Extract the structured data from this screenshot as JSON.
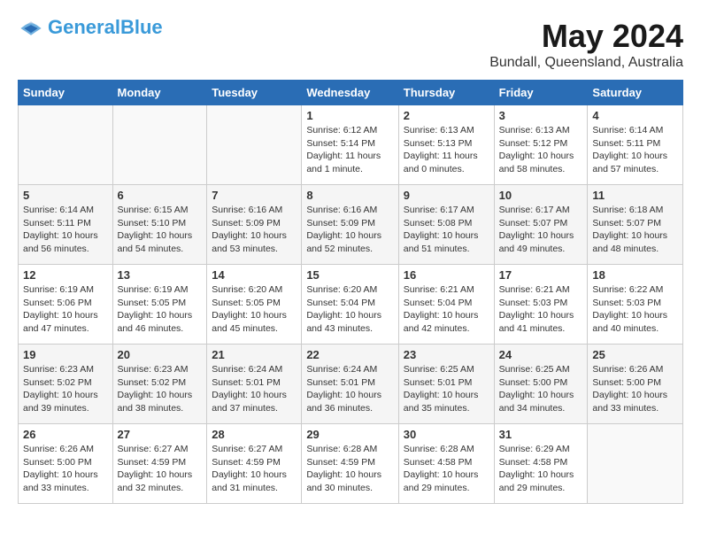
{
  "header": {
    "logo_general": "General",
    "logo_blue": "Blue",
    "month": "May 2024",
    "location": "Bundall, Queensland, Australia"
  },
  "weekdays": [
    "Sunday",
    "Monday",
    "Tuesday",
    "Wednesday",
    "Thursday",
    "Friday",
    "Saturday"
  ],
  "weeks": [
    [
      {
        "day": "",
        "info": ""
      },
      {
        "day": "",
        "info": ""
      },
      {
        "day": "",
        "info": ""
      },
      {
        "day": "1",
        "info": "Sunrise: 6:12 AM\nSunset: 5:14 PM\nDaylight: 11 hours\nand 1 minute."
      },
      {
        "day": "2",
        "info": "Sunrise: 6:13 AM\nSunset: 5:13 PM\nDaylight: 11 hours\nand 0 minutes."
      },
      {
        "day": "3",
        "info": "Sunrise: 6:13 AM\nSunset: 5:12 PM\nDaylight: 10 hours\nand 58 minutes."
      },
      {
        "day": "4",
        "info": "Sunrise: 6:14 AM\nSunset: 5:11 PM\nDaylight: 10 hours\nand 57 minutes."
      }
    ],
    [
      {
        "day": "5",
        "info": "Sunrise: 6:14 AM\nSunset: 5:11 PM\nDaylight: 10 hours\nand 56 minutes."
      },
      {
        "day": "6",
        "info": "Sunrise: 6:15 AM\nSunset: 5:10 PM\nDaylight: 10 hours\nand 54 minutes."
      },
      {
        "day": "7",
        "info": "Sunrise: 6:16 AM\nSunset: 5:09 PM\nDaylight: 10 hours\nand 53 minutes."
      },
      {
        "day": "8",
        "info": "Sunrise: 6:16 AM\nSunset: 5:09 PM\nDaylight: 10 hours\nand 52 minutes."
      },
      {
        "day": "9",
        "info": "Sunrise: 6:17 AM\nSunset: 5:08 PM\nDaylight: 10 hours\nand 51 minutes."
      },
      {
        "day": "10",
        "info": "Sunrise: 6:17 AM\nSunset: 5:07 PM\nDaylight: 10 hours\nand 49 minutes."
      },
      {
        "day": "11",
        "info": "Sunrise: 6:18 AM\nSunset: 5:07 PM\nDaylight: 10 hours\nand 48 minutes."
      }
    ],
    [
      {
        "day": "12",
        "info": "Sunrise: 6:19 AM\nSunset: 5:06 PM\nDaylight: 10 hours\nand 47 minutes."
      },
      {
        "day": "13",
        "info": "Sunrise: 6:19 AM\nSunset: 5:05 PM\nDaylight: 10 hours\nand 46 minutes."
      },
      {
        "day": "14",
        "info": "Sunrise: 6:20 AM\nSunset: 5:05 PM\nDaylight: 10 hours\nand 45 minutes."
      },
      {
        "day": "15",
        "info": "Sunrise: 6:20 AM\nSunset: 5:04 PM\nDaylight: 10 hours\nand 43 minutes."
      },
      {
        "day": "16",
        "info": "Sunrise: 6:21 AM\nSunset: 5:04 PM\nDaylight: 10 hours\nand 42 minutes."
      },
      {
        "day": "17",
        "info": "Sunrise: 6:21 AM\nSunset: 5:03 PM\nDaylight: 10 hours\nand 41 minutes."
      },
      {
        "day": "18",
        "info": "Sunrise: 6:22 AM\nSunset: 5:03 PM\nDaylight: 10 hours\nand 40 minutes."
      }
    ],
    [
      {
        "day": "19",
        "info": "Sunrise: 6:23 AM\nSunset: 5:02 PM\nDaylight: 10 hours\nand 39 minutes."
      },
      {
        "day": "20",
        "info": "Sunrise: 6:23 AM\nSunset: 5:02 PM\nDaylight: 10 hours\nand 38 minutes."
      },
      {
        "day": "21",
        "info": "Sunrise: 6:24 AM\nSunset: 5:01 PM\nDaylight: 10 hours\nand 37 minutes."
      },
      {
        "day": "22",
        "info": "Sunrise: 6:24 AM\nSunset: 5:01 PM\nDaylight: 10 hours\nand 36 minutes."
      },
      {
        "day": "23",
        "info": "Sunrise: 6:25 AM\nSunset: 5:01 PM\nDaylight: 10 hours\nand 35 minutes."
      },
      {
        "day": "24",
        "info": "Sunrise: 6:25 AM\nSunset: 5:00 PM\nDaylight: 10 hours\nand 34 minutes."
      },
      {
        "day": "25",
        "info": "Sunrise: 6:26 AM\nSunset: 5:00 PM\nDaylight: 10 hours\nand 33 minutes."
      }
    ],
    [
      {
        "day": "26",
        "info": "Sunrise: 6:26 AM\nSunset: 5:00 PM\nDaylight: 10 hours\nand 33 minutes."
      },
      {
        "day": "27",
        "info": "Sunrise: 6:27 AM\nSunset: 4:59 PM\nDaylight: 10 hours\nand 32 minutes."
      },
      {
        "day": "28",
        "info": "Sunrise: 6:27 AM\nSunset: 4:59 PM\nDaylight: 10 hours\nand 31 minutes."
      },
      {
        "day": "29",
        "info": "Sunrise: 6:28 AM\nSunset: 4:59 PM\nDaylight: 10 hours\nand 30 minutes."
      },
      {
        "day": "30",
        "info": "Sunrise: 6:28 AM\nSunset: 4:58 PM\nDaylight: 10 hours\nand 29 minutes."
      },
      {
        "day": "31",
        "info": "Sunrise: 6:29 AM\nSunset: 4:58 PM\nDaylight: 10 hours\nand 29 minutes."
      },
      {
        "day": "",
        "info": ""
      }
    ]
  ]
}
